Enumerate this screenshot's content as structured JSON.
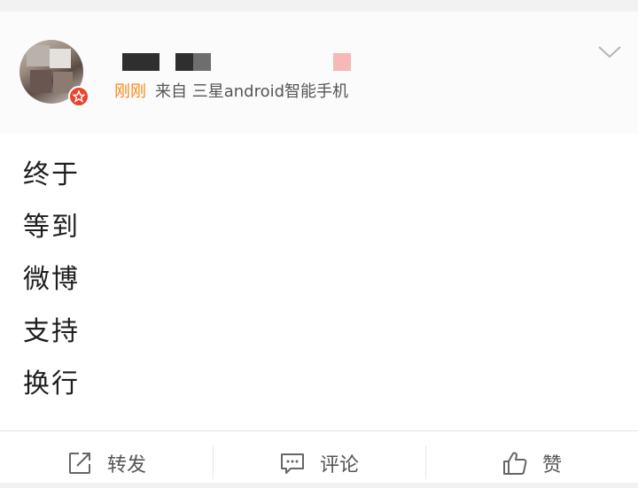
{
  "post": {
    "time": "刚刚",
    "source": "来自 三星android智能手机",
    "content_lines": [
      "终于",
      "等到",
      "微博",
      "支持",
      "换行"
    ]
  },
  "actions": {
    "repost": {
      "label": "转发",
      "icon": "repost-icon"
    },
    "comment": {
      "label": "评论",
      "icon": "comment-icon"
    },
    "like": {
      "label": "赞",
      "icon": "thumbs-up-icon"
    }
  },
  "colors": {
    "time": "#f28a18",
    "badge": "#e8452f",
    "text": "#1e1e1e",
    "secondary": "#555555"
  }
}
